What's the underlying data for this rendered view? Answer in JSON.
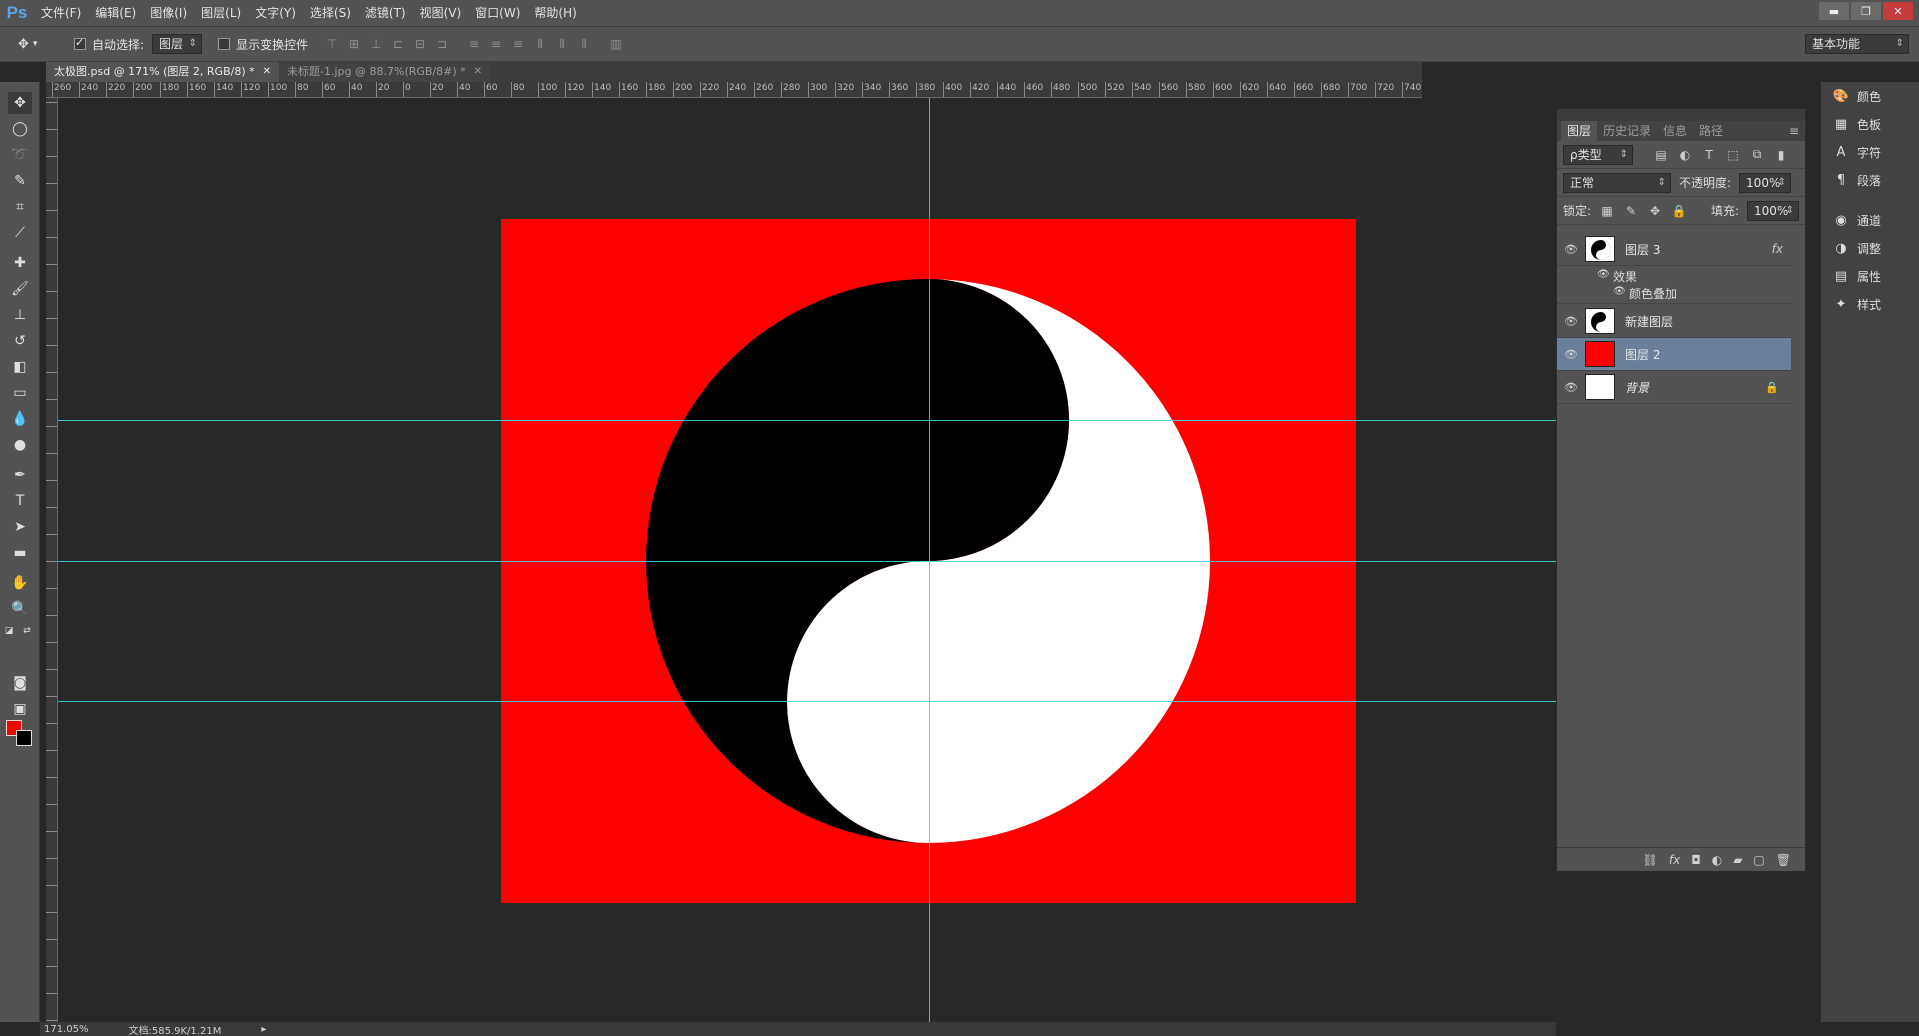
{
  "app": {
    "logo": "Ps"
  },
  "menu": [
    "文件(F)",
    "编辑(E)",
    "图像(I)",
    "图层(L)",
    "文字(Y)",
    "选择(S)",
    "滤镜(T)",
    "视图(V)",
    "窗口(W)",
    "帮助(H)"
  ],
  "window_controls": {
    "minimize": "▬",
    "restore": "❐",
    "close": "✕"
  },
  "options": {
    "auto_select_label": "自动选择:",
    "auto_select_target": "图层",
    "show_transform_label": "显示变换控件",
    "workspace": "基本功能"
  },
  "tabs": [
    {
      "label": "太极图.psd @ 171% (图层 2, RGB/8) *",
      "close": "✕"
    },
    {
      "label": "未标题-1.jpg @ 88.7%(RGB/8#) *",
      "close": "✕"
    }
  ],
  "ruler": {
    "labels": [
      "260",
      "240",
      "220",
      "200",
      "180",
      "160",
      "140",
      "120",
      "100",
      "80",
      "60",
      "40",
      "20",
      "0",
      "20",
      "40",
      "60",
      "80",
      "100",
      "120",
      "140",
      "160",
      "180",
      "200",
      "220",
      "240",
      "260",
      "280",
      "300",
      "320",
      "340",
      "360",
      "380",
      "400",
      "420",
      "440",
      "460",
      "480",
      "500",
      "520",
      "540",
      "560",
      "580",
      "600",
      "620",
      "640",
      "660",
      "680",
      "700",
      "720",
      "740"
    ]
  },
  "layers_panel": {
    "tabs": [
      "图层",
      "历史记录",
      "信息",
      "路径"
    ],
    "filter": "ρ类型",
    "blend_mode": "正常",
    "opacity_label": "不透明度:",
    "opacity_value": "100%",
    "lock_label": "锁定:",
    "fill_label": "填充:",
    "fill_value": "100%",
    "layers": [
      {
        "name": "图层 3",
        "fx": "fx"
      },
      {
        "effects_label": "效果",
        "effect_name": "颜色叠加"
      },
      {
        "name": "新建图层"
      },
      {
        "name": "图层 2"
      },
      {
        "name": "背景"
      }
    ]
  },
  "dock": [
    {
      "label": "颜色",
      "icon": "color-icon"
    },
    {
      "label": "色板",
      "icon": "swatches-icon"
    },
    {
      "label": "字符",
      "icon": "character-icon"
    },
    {
      "label": "段落",
      "icon": "paragraph-icon"
    },
    {
      "label": "通道",
      "icon": "channels-icon"
    },
    {
      "label": "调整",
      "icon": "adjustments-icon"
    },
    {
      "label": "属性",
      "icon": "properties-icon"
    },
    {
      "label": "样式",
      "icon": "styles-icon"
    }
  ],
  "status": {
    "zoom": "171.05%",
    "doc_size": "文档:585.9K/1.21M"
  },
  "colors": {
    "canvas_bg": "#ff0000",
    "foreground": "#ff0000",
    "background": "#000000",
    "guide": "#3fd3d8",
    "selected_layer": "#6b7f99"
  }
}
